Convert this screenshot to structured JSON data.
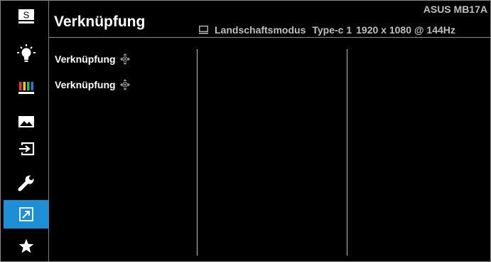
{
  "header": {
    "title": "Verknüpfung",
    "model": "ASUS MB17A"
  },
  "status_bar": {
    "orientation_icon": "monitor-landscape-icon",
    "orientation": "Landschaftsmodus",
    "input": "Type-c 1",
    "resolution": "1920 x 1080 @ 144Hz"
  },
  "sidebar": {
    "items": [
      {
        "name": "splendid",
        "icon": "splendid-s-icon",
        "active": false
      },
      {
        "name": "blue-light-filter",
        "icon": "lightbulb-icon",
        "active": false
      },
      {
        "name": "color",
        "icon": "color-bars-icon",
        "active": false
      },
      {
        "name": "image",
        "icon": "image-icon",
        "active": false
      },
      {
        "name": "input-select",
        "icon": "input-arrow-icon",
        "active": false
      },
      {
        "name": "system-setup",
        "icon": "wrench-icon",
        "active": false
      },
      {
        "name": "shortcut",
        "icon": "shortcut-arrow-icon",
        "active": true
      },
      {
        "name": "my-favorite",
        "icon": "star-icon",
        "active": false
      }
    ]
  },
  "menu": {
    "items": [
      {
        "label": "Verknüpfung",
        "icon": "joystick-4way-icon"
      },
      {
        "label": "Verknüpfung",
        "icon": "joystick-4way-icon"
      }
    ]
  },
  "colors": {
    "background": "#000000",
    "accent": "#1c8fd6",
    "text": "#ffffff",
    "secondary_text": "#bfbfbf"
  }
}
